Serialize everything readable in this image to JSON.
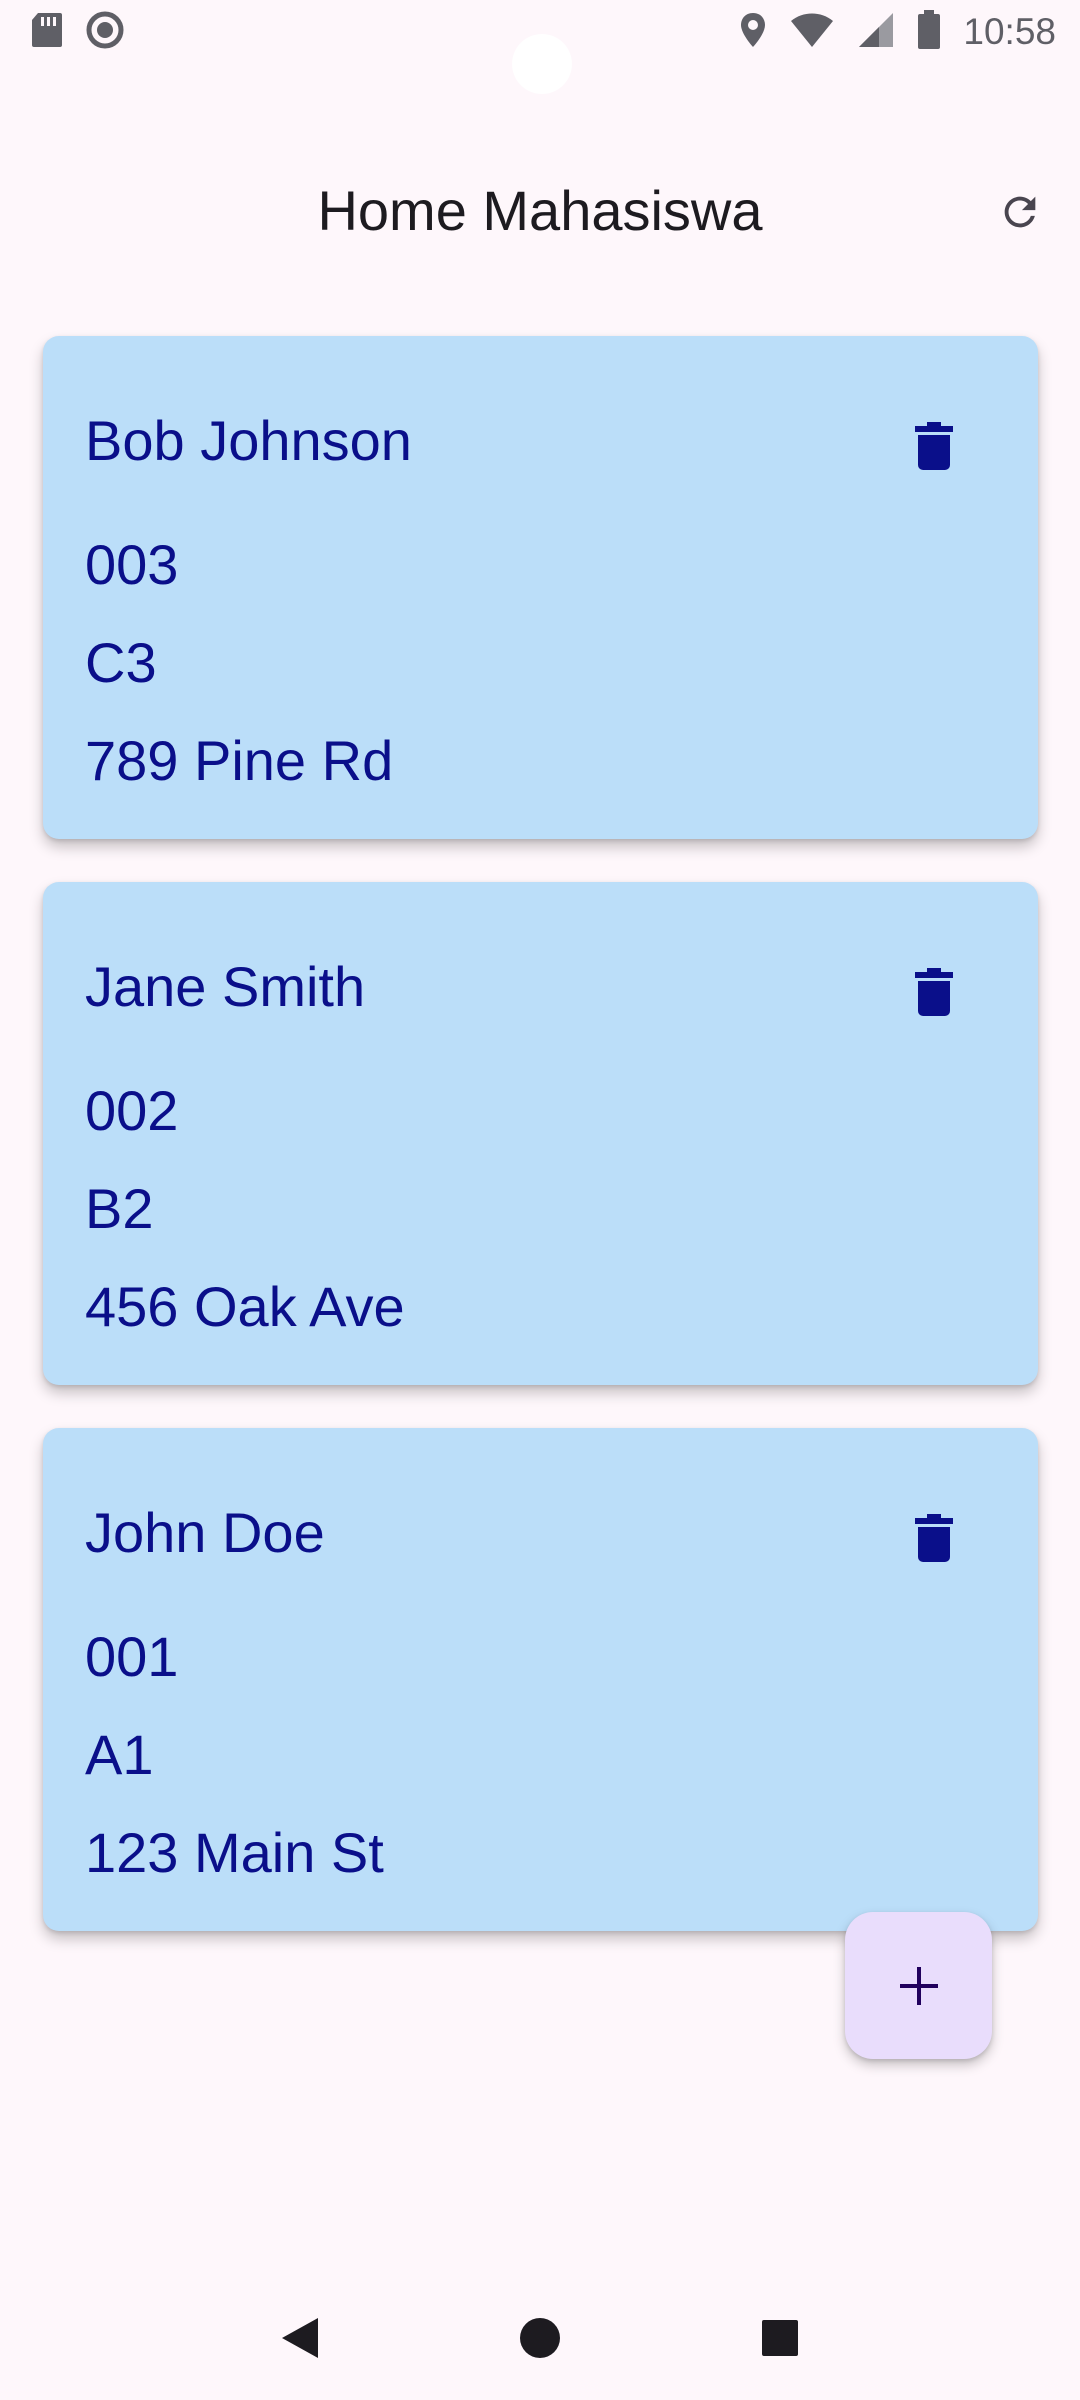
{
  "status_bar": {
    "time": "10:58",
    "left_icons": [
      "sd-card-icon",
      "record-icon"
    ],
    "right_icons": [
      "location-icon",
      "wifi-icon",
      "signal-icon",
      "battery-icon"
    ]
  },
  "app_bar": {
    "title": "Home Mahasiswa",
    "action_icon": "refresh-icon"
  },
  "students": [
    {
      "name": "Bob Johnson",
      "id": "003",
      "class": "C3",
      "address": "789 Pine Rd"
    },
    {
      "name": "Jane Smith",
      "id": "002",
      "class": "B2",
      "address": "456 Oak Ave"
    },
    {
      "name": "John Doe",
      "id": "001",
      "class": "A1",
      "address": "123 Main St"
    }
  ],
  "card_action_icon": "delete-icon",
  "fab": {
    "label": "+",
    "icon": "add-icon"
  },
  "nav_bar": {
    "icons": [
      "back-icon",
      "home-icon",
      "recents-icon"
    ]
  },
  "colors": {
    "background": "#fef7fb",
    "card": "#bbdef9",
    "card_text": "#0a0f8a",
    "fab": "#e9ddfc",
    "title_text": "#1d1b20"
  }
}
